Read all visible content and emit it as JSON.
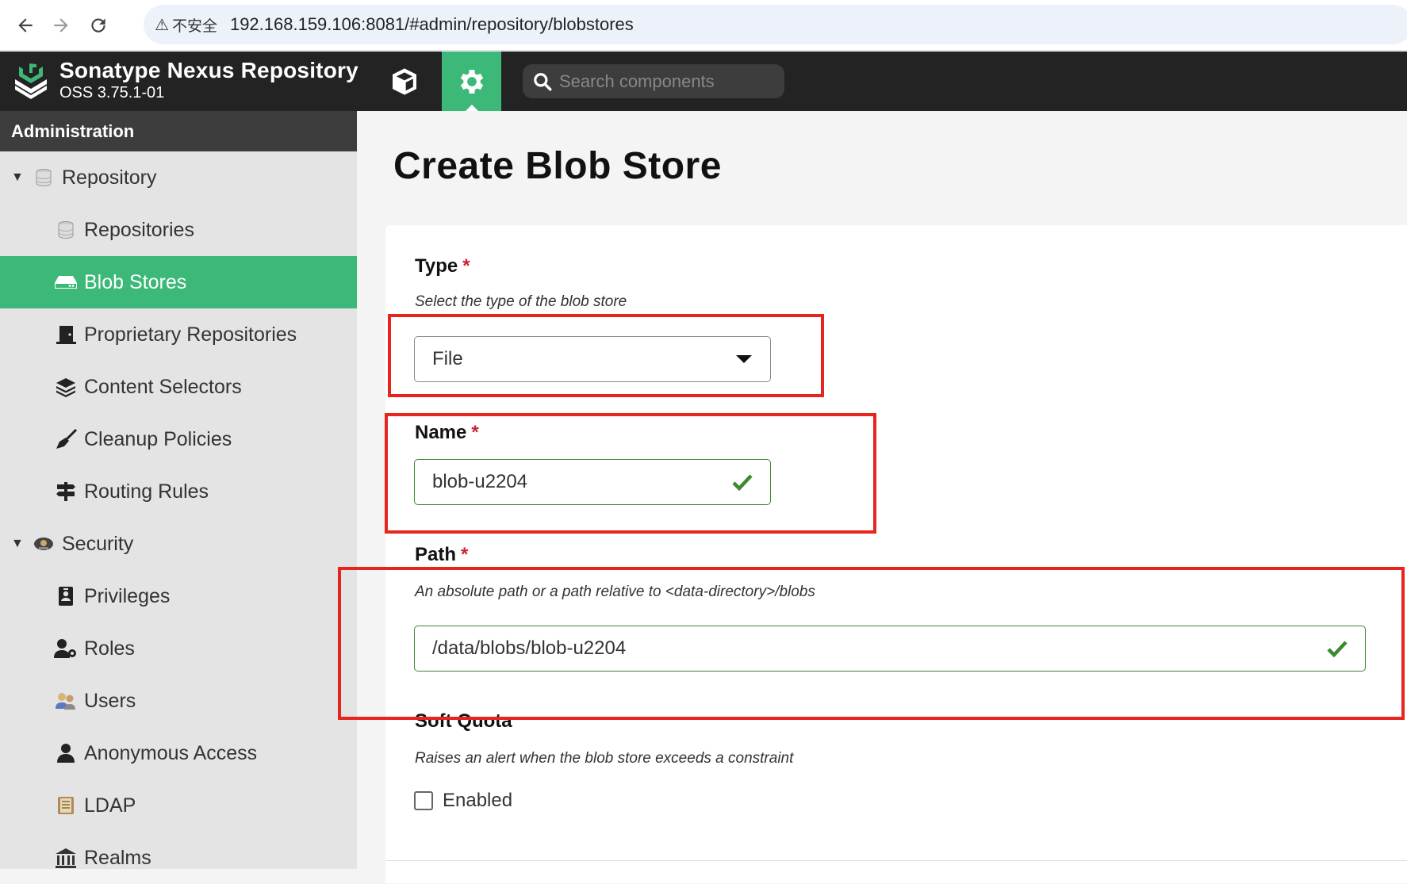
{
  "browser": {
    "back_icon": "arrow-left-icon",
    "forward_icon": "arrow-right-icon",
    "reload_icon": "reload-icon",
    "security_label": "不安全",
    "url": "192.168.159.106:8081/#admin/repository/blobstores"
  },
  "header": {
    "title": "Sonatype Nexus Repository",
    "version": "OSS 3.75.1-01",
    "search_placeholder": "Search components"
  },
  "sidebar": {
    "section_title": "Administration",
    "groups": [
      {
        "label": "Repository",
        "icon": "database-icon",
        "items": [
          {
            "label": "Repositories",
            "icon": "database-icon"
          },
          {
            "label": "Blob Stores",
            "icon": "hard-drive-icon",
            "active": true
          },
          {
            "label": "Proprietary Repositories",
            "icon": "door-icon"
          },
          {
            "label": "Content Selectors",
            "icon": "layers-icon"
          },
          {
            "label": "Cleanup Policies",
            "icon": "broom-icon"
          },
          {
            "label": "Routing Rules",
            "icon": "signpost-icon"
          }
        ]
      },
      {
        "label": "Security",
        "icon": "security-badge-icon",
        "items": [
          {
            "label": "Privileges",
            "icon": "id-badge-icon"
          },
          {
            "label": "Roles",
            "icon": "user-gear-icon"
          },
          {
            "label": "Users",
            "icon": "users-icon"
          },
          {
            "label": "Anonymous Access",
            "icon": "user-icon"
          },
          {
            "label": "LDAP",
            "icon": "book-icon"
          },
          {
            "label": "Realms",
            "icon": "building-icon"
          }
        ]
      }
    ]
  },
  "form": {
    "page_title": "Create Blob Store",
    "type": {
      "label": "Type",
      "required_mark": "*",
      "help": "Select the type of the blob store",
      "value": "File"
    },
    "name": {
      "label": "Name",
      "required_mark": "*",
      "value": "blob-u2204"
    },
    "path": {
      "label": "Path",
      "required_mark": "*",
      "help": "An absolute path or a path relative to <data-directory>/blobs",
      "value": "/data/blobs/blob-u2204"
    },
    "soft_quota": {
      "label": "Soft Quota",
      "help": "Raises an alert when the blob store exceeds a constraint",
      "checkbox_label": "Enabled",
      "checked": false
    }
  },
  "colors": {
    "accent": "#3cb878",
    "header_bg": "#232323",
    "annotation": "#e8241e",
    "valid": "#3b8a2e",
    "required": "#cc2233"
  }
}
